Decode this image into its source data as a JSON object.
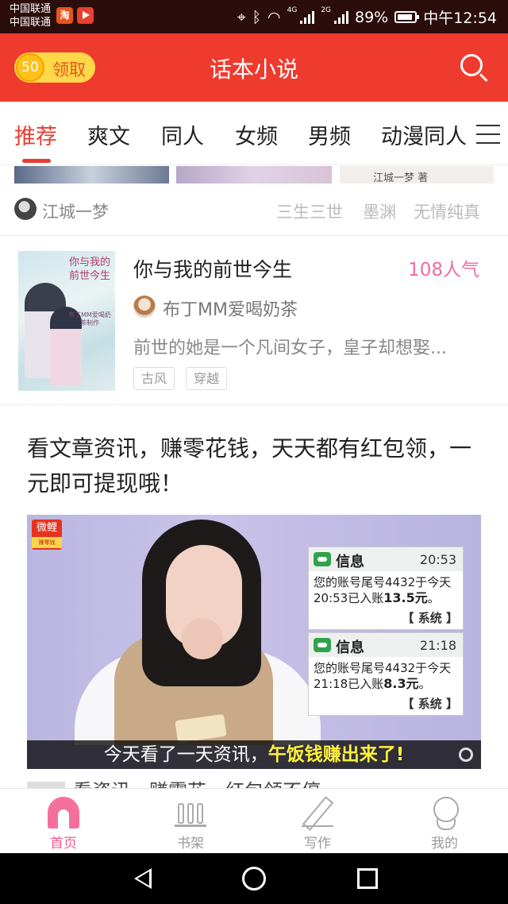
{
  "status_bar": {
    "carrier1": "中国联通",
    "carrier2": "中国联通",
    "app_icon_1": "淘",
    "signal_tag_1": "4G",
    "signal_tag_2": "2G",
    "battery": "89%",
    "time": "中午12:54"
  },
  "header": {
    "coin_count": "50",
    "coin_label": "领取",
    "title": "话本小说",
    "accent_color": "#ef3a2e"
  },
  "tabs": [
    {
      "label": "推荐",
      "active": true
    },
    {
      "label": "爽文"
    },
    {
      "label": "同人"
    },
    {
      "label": "女频"
    },
    {
      "label": "男频"
    },
    {
      "label": "动漫同人"
    }
  ],
  "cover_strip_text": "江城一梦 著",
  "author_row": {
    "author": "江城一梦",
    "works": [
      "三生三世",
      "墨渊",
      "无情纯真"
    ]
  },
  "book": {
    "title": "你与我的前世今生",
    "popularity": "108人气",
    "author": "布丁MM爱喝奶茶",
    "description": "前世的她是一个凡间女子，皇子却想娶...",
    "tags": [
      "古风",
      "穿越"
    ],
    "cover_title": "你与我的前世今生",
    "cover_subtitle": "布丁MM爱喝奶茶制作"
  },
  "article": {
    "title": "看文章资讯，赚零花钱，天天都有红包领，一元即可提现哦！",
    "image_logo": "微鲤",
    "image_logo_sub": "赚零钱",
    "messages": [
      {
        "label": "信息",
        "time": "20:53",
        "body_prefix": "您的账号尾号4432于今天20:53已入账",
        "amount": "13.5元",
        "body_suffix": "。",
        "source": "【 系统 】"
      },
      {
        "label": "信息",
        "time": "21:18",
        "body_prefix": "您的账号尾号4432于今天21:18已入账",
        "amount": "8.3元",
        "body_suffix": "。",
        "source": "【 系统 】"
      }
    ],
    "caption_normal": "今天看了一天资讯，",
    "caption_highlight": "午饭钱赚出来了!"
  },
  "next_item_title": "看资讯，赚零花，红包领不停",
  "bottom_nav": [
    {
      "label": "首页",
      "icon": "home-icon",
      "active": true
    },
    {
      "label": "书架",
      "icon": "bookshelf-icon"
    },
    {
      "label": "写作",
      "icon": "pen-icon"
    },
    {
      "label": "我的",
      "icon": "profile-icon"
    }
  ],
  "colors": {
    "primary": "#ef3a2e",
    "active_tab": "#e83c33",
    "popularity": "#f06ca0",
    "nav_active": "#f05a8e"
  }
}
